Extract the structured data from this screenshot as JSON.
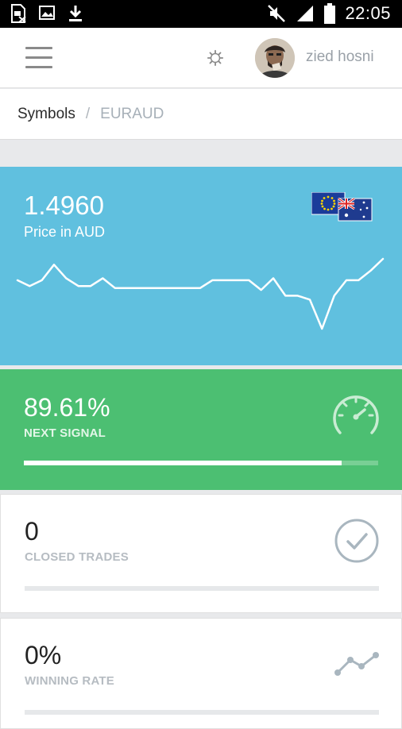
{
  "status_bar": {
    "time": "22:05",
    "icons": [
      "sim-card-icon",
      "image-icon",
      "download-icon",
      "mute-icon",
      "signal-icon",
      "battery-icon"
    ]
  },
  "header": {
    "menu_icon": "hamburger-menu-icon",
    "settings_icon": "gear-icon",
    "username": "zied hosni"
  },
  "breadcrumb": {
    "root": "Symbols",
    "separator": "/",
    "current": "EURAUD"
  },
  "price_card": {
    "value": "1.4960",
    "label": "Price in AUD",
    "color": "#60c0df",
    "flags": [
      "eu-flag-icon",
      "au-flag-icon"
    ],
    "chart_data": {
      "type": "line",
      "values": [
        1.4965,
        1.4962,
        1.4965,
        1.4973,
        1.4966,
        1.4962,
        1.4962,
        1.4966,
        1.4961,
        1.4961,
        1.4961,
        1.4961,
        1.4961,
        1.4961,
        1.4961,
        1.4961,
        1.4965,
        1.4965,
        1.4965,
        1.4965,
        1.496,
        1.4966,
        1.4957,
        1.4957,
        1.4955,
        1.494,
        1.4957,
        1.4965,
        1.4965,
        1.497,
        1.4976
      ]
    }
  },
  "signal_card": {
    "value": "89.61%",
    "label": "NEXT SIGNAL",
    "progress_percent": 89.61,
    "color": "#4cbf72",
    "icon": "speedometer-icon"
  },
  "closed_trades": {
    "value": "0",
    "label": "CLOSED TRADES",
    "progress_percent": 0,
    "icon": "check-circle-icon"
  },
  "winning_rate": {
    "value": "0%",
    "label": "WINNING RATE",
    "progress_percent": 0,
    "icon": "trend-line-icon"
  }
}
